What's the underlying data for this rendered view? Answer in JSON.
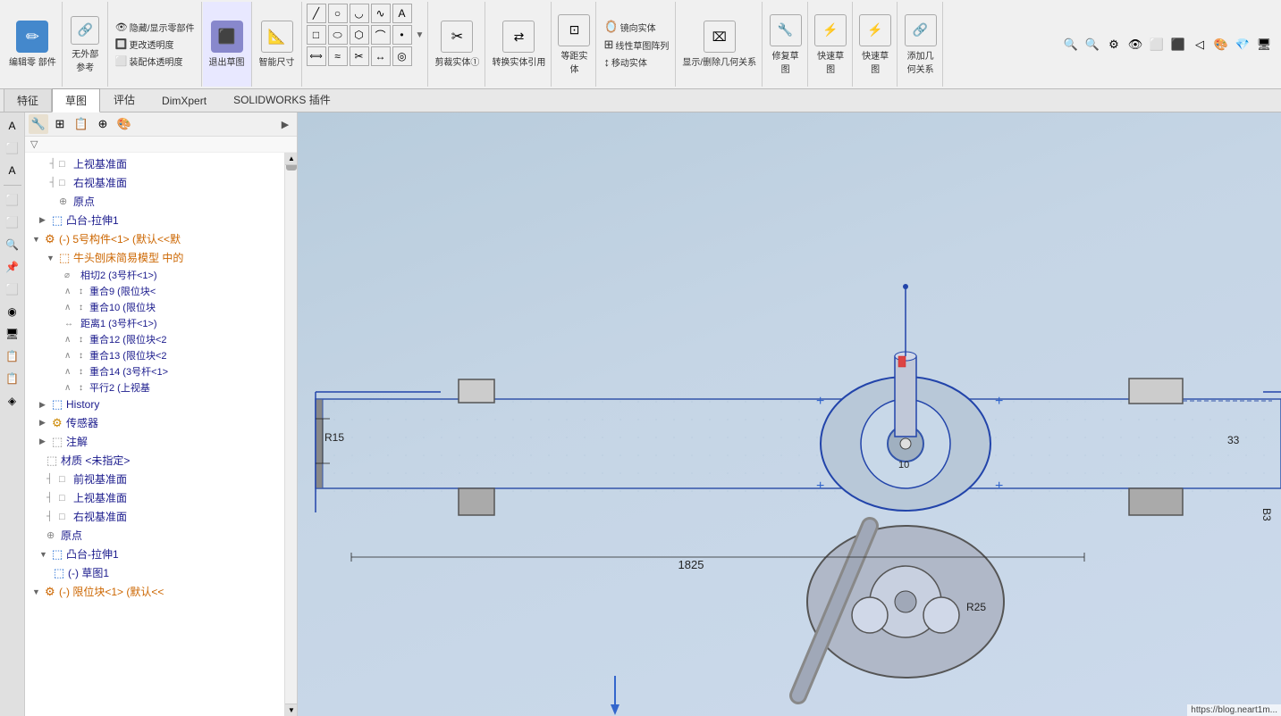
{
  "toolbar": {
    "sections": [
      {
        "id": "edit-part",
        "icon": "✏️",
        "label": "编辑零\n部件"
      },
      {
        "id": "no-external",
        "icon": "",
        "label": "无外部\n参考"
      },
      {
        "id": "hide-show",
        "label": "隐藏/显示零部件"
      },
      {
        "id": "change-transparency",
        "label": "更改透明度"
      },
      {
        "id": "assembly-transparency",
        "label": "装配体透明度"
      },
      {
        "id": "exit-drawing",
        "label": "退出草图"
      },
      {
        "id": "smart-dim",
        "label": "智能尺寸"
      },
      {
        "id": "trim-solid",
        "label": "剪裁实体①"
      },
      {
        "id": "convert-solid",
        "label": "转换实体引用"
      },
      {
        "id": "equal-dist",
        "label": "等距实\n体"
      },
      {
        "id": "linear-pattern",
        "label": "线性草图阵列"
      },
      {
        "id": "show-delete",
        "label": "显示/删除几何关系"
      },
      {
        "id": "repair-sketch",
        "label": "修复草\n图"
      },
      {
        "id": "fast-sketch",
        "label": "快速草\n图"
      },
      {
        "id": "fast-sketch2",
        "label": "快速草\n图"
      },
      {
        "id": "add-relation",
        "label": "添加几\n何关系"
      }
    ]
  },
  "tabs": [
    {
      "id": "features",
      "label": "特征"
    },
    {
      "id": "sketch",
      "label": "草图",
      "active": true
    },
    {
      "id": "evaluate",
      "label": "评估"
    },
    {
      "id": "dimxpert",
      "label": "DimXpert"
    },
    {
      "id": "solidworks-plugin",
      "label": "SOLIDWORKS 插件"
    }
  ],
  "tree": {
    "items": [
      {
        "id": "top-plane",
        "level": 1,
        "icon": "plane",
        "label": "上视基准面",
        "expandable": false,
        "expanded": false
      },
      {
        "id": "right-plane",
        "level": 1,
        "icon": "plane",
        "label": "右视基准面",
        "expandable": false,
        "expanded": false
      },
      {
        "id": "origin",
        "level": 1,
        "icon": "origin",
        "label": "原点",
        "expandable": false,
        "expanded": false
      },
      {
        "id": "boss-extrude1",
        "level": 1,
        "icon": "boss",
        "label": "凸台-拉伸1",
        "expandable": true,
        "expanded": false
      },
      {
        "id": "component5",
        "level": 1,
        "icon": "component",
        "label": "(-) 5号构件<1> (默认<<默",
        "expandable": true,
        "expanded": true,
        "color": "orange"
      },
      {
        "id": "shaper-model",
        "level": 2,
        "icon": "assembly",
        "label": "牛头刨床简易模型 中的",
        "expandable": true,
        "expanded": true,
        "color": "orange"
      },
      {
        "id": "tangent2",
        "level": 3,
        "icon": "constraint",
        "label": "相切2 (3号杆<1>)"
      },
      {
        "id": "coincident9",
        "level": 3,
        "icon": "constraint",
        "label": "重合9 (限位块<"
      },
      {
        "id": "coincident10",
        "level": 3,
        "icon": "constraint",
        "label": "重合10 (限位块"
      },
      {
        "id": "distance1",
        "level": 3,
        "icon": "constraint",
        "label": "距离1 (3号杆<1>)"
      },
      {
        "id": "coincident12",
        "level": 3,
        "icon": "constraint",
        "label": "重合12 (限位块<2"
      },
      {
        "id": "coincident13",
        "level": 3,
        "icon": "constraint",
        "label": "重合13 (限位块<2"
      },
      {
        "id": "coincident14",
        "level": 3,
        "icon": "constraint",
        "label": "重合14 (3号杆<1>"
      },
      {
        "id": "parallel2",
        "level": 3,
        "icon": "constraint",
        "label": "平行2 (上视基"
      },
      {
        "id": "history",
        "level": 1,
        "icon": "history",
        "label": "History",
        "expandable": true,
        "expanded": false
      },
      {
        "id": "sensor",
        "level": 1,
        "icon": "sensor",
        "label": "传感器",
        "expandable": true,
        "expanded": false
      },
      {
        "id": "notes",
        "level": 1,
        "icon": "notes",
        "label": "注解",
        "expandable": true,
        "expanded": false
      },
      {
        "id": "material",
        "level": 1,
        "icon": "material",
        "label": "材质 <未指定>"
      },
      {
        "id": "front-plane2",
        "level": 1,
        "icon": "plane",
        "label": "前视基准面"
      },
      {
        "id": "top-plane2",
        "level": 1,
        "icon": "plane",
        "label": "上视基准面"
      },
      {
        "id": "right-plane2",
        "level": 1,
        "icon": "plane",
        "label": "右视基准面"
      },
      {
        "id": "origin2",
        "level": 1,
        "icon": "origin",
        "label": "原点"
      },
      {
        "id": "boss-extrude1b",
        "level": 1,
        "icon": "boss",
        "label": "凸台-拉伸1",
        "expandable": true,
        "expanded": true,
        "color": "blue"
      },
      {
        "id": "sketch1",
        "level": 2,
        "icon": "sketch",
        "label": "(-) 草图1"
      }
    ]
  },
  "canvas": {
    "dimension_1825": "1825",
    "dimension_r15": "R15",
    "dimension_r25": "R25",
    "dimension_10": "10",
    "dimension_33": "33",
    "dimension_b3": "B3"
  },
  "statusbar": {
    "url": "https://blog.neart1m..."
  }
}
